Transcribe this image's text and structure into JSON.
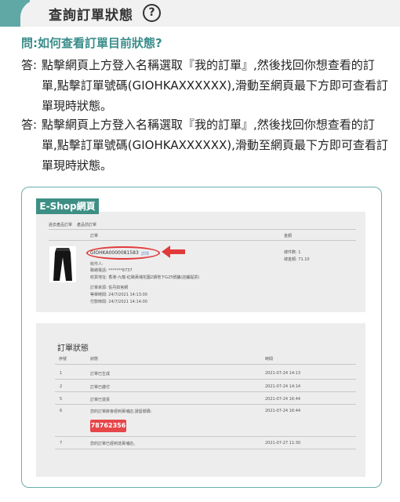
{
  "header": {
    "title": "查詢訂單狀態",
    "help_icon": "?"
  },
  "faq": {
    "question": "問:如何查看訂單目前狀態?",
    "answers": [
      {
        "label": "答:",
        "text": "點擊網頁上方登入名稱選取『我的訂單』,然後找回你想查看的訂單,點擊訂單號碼(GIOHKAXXXXXX),滑動至網頁最下方即可查看訂單現時狀態。"
      },
      {
        "label": "答:",
        "text": "點擊網頁上方登入名稱選取『我的訂單』,然後找回你想查看的訂單,點擊訂單號碼(GIOHKAXXXXXX),滑動至網頁最下方即可查看訂單現時狀態。"
      }
    ]
  },
  "eshop": {
    "tab_label": "E-Shop網頁",
    "nav": {
      "item1": "過去產品訂單",
      "item2": "產品前訂單"
    },
    "order_table": {
      "col_order": "訂單",
      "col_amount": "金額",
      "order_no": "GIOHKA0000081583",
      "order_link": "詳情",
      "contact": "收件人:",
      "phone": "聯絡電話: *******8737",
      "address": "收貨地址: 香港-九龍-紅磡黃埔花園2期地下G25號舖(店舖提貨)",
      "status_line": "訂單來源: 佐丹奴官網",
      "order_time": "等單時間: 24/7/2021 14:13:00",
      "pay_time": "付款時間: 24/7/2021 14:14:00",
      "qty": "總件數: 1",
      "total": "總金額: 71.10"
    },
    "status_table": {
      "title": "訂單狀態",
      "col_no": "序號",
      "col_status": "狀態",
      "col_time": "時間",
      "rows": [
        {
          "no": "1",
          "status": "訂單已生成",
          "time": "2021-07-24 14:13"
        },
        {
          "no": "2",
          "status": "訂單已繳付",
          "time": "2021-07-24 14:14"
        },
        {
          "no": "5",
          "status": "訂單已發貨",
          "time": "2021-07-24 16:44"
        },
        {
          "no": "6",
          "status": "您的訂單將會經到黃埔店,請留號碼:",
          "time": "2021-07-24 16:44"
        },
        {
          "no": "7",
          "status": "您的訂單已經到達黃埔店。",
          "time": "2021-07-27 11:30"
        }
      ],
      "pickup_code": "78762356"
    }
  },
  "colors": {
    "teal": "#3d8f85",
    "accent_red": "#e64549",
    "question_teal": "#3a8d8a"
  }
}
